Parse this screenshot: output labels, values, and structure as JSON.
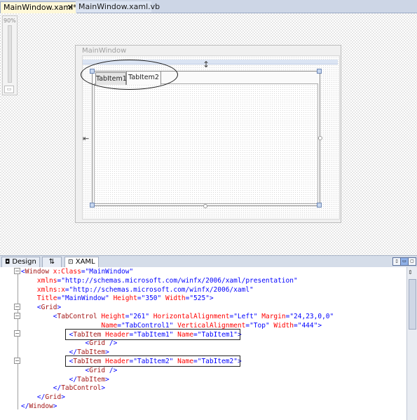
{
  "doc_tabs": [
    {
      "label": "MainWindow.xaml*",
      "active": true
    },
    {
      "label": "MainWindow.xaml.vb",
      "active": false
    }
  ],
  "designer": {
    "zoom": "90%",
    "window_title": "MainWindow",
    "tab_items": [
      "TabItem1",
      "TabItem2"
    ],
    "selected_tab": "TabItem2"
  },
  "pane_tabs": {
    "design": "Design",
    "swap": "⇅",
    "xaml": "XAML"
  },
  "code_lines": [
    [
      {
        "t": "<",
        "c": "b"
      },
      {
        "t": "Window",
        "c": "t"
      },
      {
        "t": " x:Class",
        "c": "a"
      },
      {
        "t": "=",
        "c": "b"
      },
      {
        "t": "\"MainWindow\"",
        "c": "v"
      }
    ],
    [
      {
        "t": "    xmlns",
        "c": "a"
      },
      {
        "t": "=",
        "c": "b"
      },
      {
        "t": "\"http://schemas.microsoft.com/winfx/2006/xaml/presentation\"",
        "c": "v"
      }
    ],
    [
      {
        "t": "    xmlns:x",
        "c": "a"
      },
      {
        "t": "=",
        "c": "b"
      },
      {
        "t": "\"http://schemas.microsoft.com/winfx/2006/xaml\"",
        "c": "v"
      }
    ],
    [
      {
        "t": "    Title",
        "c": "a"
      },
      {
        "t": "=",
        "c": "b"
      },
      {
        "t": "\"MainWindow\"",
        "c": "v"
      },
      {
        "t": " Height",
        "c": "a"
      },
      {
        "t": "=",
        "c": "b"
      },
      {
        "t": "\"350\"",
        "c": "v"
      },
      {
        "t": " Width",
        "c": "a"
      },
      {
        "t": "=",
        "c": "b"
      },
      {
        "t": "\"525\"",
        "c": "v"
      },
      {
        "t": ">",
        "c": "b"
      }
    ],
    [
      {
        "t": "    <",
        "c": "b"
      },
      {
        "t": "Grid",
        "c": "t"
      },
      {
        "t": ">",
        "c": "b"
      }
    ],
    [
      {
        "t": "        <",
        "c": "b"
      },
      {
        "t": "TabControl",
        "c": "t"
      },
      {
        "t": " Height",
        "c": "a"
      },
      {
        "t": "=",
        "c": "b"
      },
      {
        "t": "\"261\"",
        "c": "v"
      },
      {
        "t": " HorizontalAlignment",
        "c": "a"
      },
      {
        "t": "=",
        "c": "b"
      },
      {
        "t": "\"Left\"",
        "c": "v"
      },
      {
        "t": " Margin",
        "c": "a"
      },
      {
        "t": "=",
        "c": "b"
      },
      {
        "t": "\"24,23,0,0\"",
        "c": "v"
      }
    ],
    [
      {
        "t": "                    Name",
        "c": "a"
      },
      {
        "t": "=",
        "c": "b"
      },
      {
        "t": "\"TabControl1\"",
        "c": "v"
      },
      {
        "t": " VerticalAlignment",
        "c": "a"
      },
      {
        "t": "=",
        "c": "b"
      },
      {
        "t": "\"Top\"",
        "c": "v"
      },
      {
        "t": " Width",
        "c": "a"
      },
      {
        "t": "=",
        "c": "b"
      },
      {
        "t": "\"444\"",
        "c": "v"
      },
      {
        "t": ">",
        "c": "b"
      }
    ],
    [
      {
        "t": "            <",
        "c": "b"
      },
      {
        "t": "TabItem",
        "c": "t"
      },
      {
        "t": " Header",
        "c": "a"
      },
      {
        "t": "=",
        "c": "b"
      },
      {
        "t": "\"TabItem1\"",
        "c": "v"
      },
      {
        "t": " Name",
        "c": "a"
      },
      {
        "t": "=",
        "c": "b"
      },
      {
        "t": "\"TabItem1\"",
        "c": "v"
      },
      {
        "t": ">",
        "c": "b"
      }
    ],
    [
      {
        "t": "                <",
        "c": "b"
      },
      {
        "t": "Grid",
        "c": "t"
      },
      {
        "t": " />",
        "c": "b"
      }
    ],
    [
      {
        "t": "            </",
        "c": "b"
      },
      {
        "t": "TabItem",
        "c": "t"
      },
      {
        "t": ">",
        "c": "b"
      }
    ],
    [
      {
        "t": "            <",
        "c": "b"
      },
      {
        "t": "TabItem",
        "c": "t"
      },
      {
        "t": " Header",
        "c": "a"
      },
      {
        "t": "=",
        "c": "b"
      },
      {
        "t": "\"TabItem2\"",
        "c": "v"
      },
      {
        "t": " Name",
        "c": "a"
      },
      {
        "t": "=",
        "c": "b"
      },
      {
        "t": "\"TabItem2\"",
        "c": "v"
      },
      {
        "t": ">",
        "c": "b"
      }
    ],
    [
      {
        "t": "                <",
        "c": "b"
      },
      {
        "t": "Grid",
        "c": "t"
      },
      {
        "t": " />",
        "c": "b"
      }
    ],
    [
      {
        "t": "            </",
        "c": "b"
      },
      {
        "t": "TabItem",
        "c": "t"
      },
      {
        "t": ">",
        "c": "b"
      }
    ],
    [
      {
        "t": "        </",
        "c": "b"
      },
      {
        "t": "TabControl",
        "c": "t"
      },
      {
        "t": ">",
        "c": "b"
      }
    ],
    [
      {
        "t": "    </",
        "c": "b"
      },
      {
        "t": "Grid",
        "c": "t"
      },
      {
        "t": ">",
        "c": "b"
      }
    ],
    [
      {
        "t": "</",
        "c": "b"
      },
      {
        "t": "Window",
        "c": "t"
      },
      {
        "t": ">",
        "c": "b"
      }
    ]
  ],
  "icons": {
    "close": "close-icon",
    "design_pane": "design-pane-icon",
    "xaml_pane": "xaml-pane-icon",
    "split_vertical": "split-vertical-icon",
    "split_horizontal": "split-horizontal-icon",
    "collapse_pane": "collapse-pane-icon"
  },
  "colors": {
    "xaml_bracket": "#0000ff",
    "xaml_tag": "#a31515",
    "xaml_attr": "#ff0000",
    "xaml_value": "#0000ff",
    "chrome": "#cdd6e6"
  }
}
